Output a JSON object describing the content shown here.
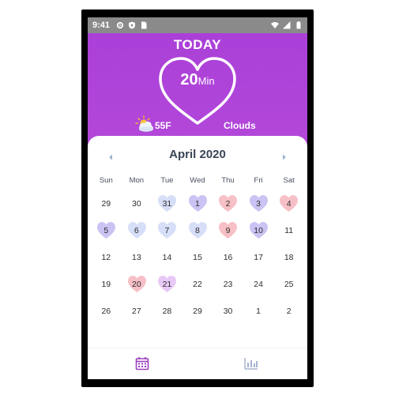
{
  "status_bar": {
    "time": "9:41",
    "left_icons": [
      "gear-icon",
      "shield-icon",
      "sim-card-icon"
    ],
    "right_icons": [
      "wifi-icon",
      "signal-icon",
      "battery-icon"
    ]
  },
  "header": {
    "title": "TODAY",
    "minutes_value": "20",
    "minutes_unit": "Min"
  },
  "weather": {
    "icon": "partly-cloudy-icon",
    "temperature": "55F",
    "condition": "Clouds"
  },
  "calendar": {
    "month_title": "April 2020",
    "prev_icon": "chevron-left-icon",
    "next_icon": "chevron-right-icon",
    "weekdays": [
      "Sun",
      "Mon",
      "Tue",
      "Wed",
      "Thu",
      "Fri",
      "Sat"
    ],
    "mood_colors": {
      "blue": "#d7def8",
      "purple": "#cbc3f3",
      "pink": "#f7c0c7",
      "lilac": "#e8c9f6"
    },
    "weeks": [
      [
        {
          "day": "29",
          "mood": ""
        },
        {
          "day": "30",
          "mood": ""
        },
        {
          "day": "31",
          "mood": "blue"
        },
        {
          "day": "1",
          "mood": "purple"
        },
        {
          "day": "2",
          "mood": "pink"
        },
        {
          "day": "3",
          "mood": "purple"
        },
        {
          "day": "4",
          "mood": "pink"
        }
      ],
      [
        {
          "day": "5",
          "mood": "purple"
        },
        {
          "day": "6",
          "mood": "blue"
        },
        {
          "day": "7",
          "mood": "blue"
        },
        {
          "day": "8",
          "mood": "blue"
        },
        {
          "day": "9",
          "mood": "pink"
        },
        {
          "day": "10",
          "mood": "purple"
        },
        {
          "day": "11",
          "mood": ""
        }
      ],
      [
        {
          "day": "12",
          "mood": ""
        },
        {
          "day": "13",
          "mood": ""
        },
        {
          "day": "14",
          "mood": ""
        },
        {
          "day": "15",
          "mood": ""
        },
        {
          "day": "16",
          "mood": ""
        },
        {
          "day": "17",
          "mood": ""
        },
        {
          "day": "18",
          "mood": ""
        }
      ],
      [
        {
          "day": "19",
          "mood": ""
        },
        {
          "day": "20",
          "mood": "pink"
        },
        {
          "day": "21",
          "mood": "lilac"
        },
        {
          "day": "22",
          "mood": ""
        },
        {
          "day": "23",
          "mood": ""
        },
        {
          "day": "24",
          "mood": ""
        },
        {
          "day": "25",
          "mood": ""
        }
      ],
      [
        {
          "day": "26",
          "mood": ""
        },
        {
          "day": "27",
          "mood": ""
        },
        {
          "day": "28",
          "mood": ""
        },
        {
          "day": "29",
          "mood": ""
        },
        {
          "day": "30",
          "mood": ""
        },
        {
          "day": "1",
          "mood": ""
        },
        {
          "day": "2",
          "mood": ""
        }
      ]
    ]
  },
  "bottom_nav": {
    "items": [
      {
        "icon": "calendar-icon",
        "active": true
      },
      {
        "icon": "bar-chart-icon",
        "active": false
      }
    ],
    "active_color": "#9b3fbf",
    "inactive_color": "#a7b6cf"
  },
  "colors": {
    "gradient_top": "#a93fd8",
    "gradient_bottom": "#c457dc",
    "month_title": "#3a4556"
  }
}
